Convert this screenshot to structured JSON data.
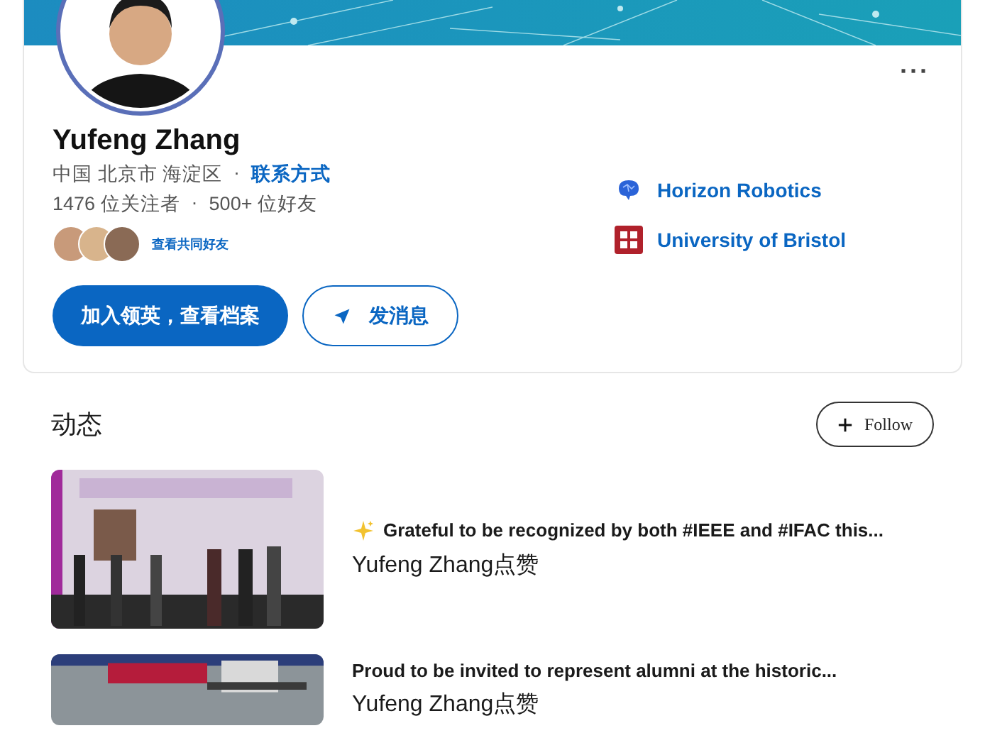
{
  "profile": {
    "name": "Yufeng Zhang",
    "location": "中国 北京市 海淀区",
    "separator": "·",
    "contact_link": "联系方式",
    "followers": "1476 位关注者",
    "connections": "500+ 位好友",
    "mutual_link": "查看共同好友",
    "mutual_avatars": [
      {
        "color": "#c89a7a"
      },
      {
        "color": "#d8b48c"
      },
      {
        "color": "#8a6a55"
      }
    ],
    "more": "···"
  },
  "organizations": [
    {
      "kind": "company",
      "name": "Horizon Robotics"
    },
    {
      "kind": "school",
      "name": "University of Bristol"
    }
  ],
  "buttons": [
    {
      "kind": "primary",
      "label": "加入领英，查看档案"
    },
    {
      "kind": "message",
      "label": "发消息"
    }
  ],
  "activity": {
    "title": "动态",
    "follow_button": "Follow",
    "posts": [
      {
        "sparkle": true,
        "text": "Grateful to be recognized by both #IEEE and #IFAC this...",
        "reaction": "Yufeng Zhang点赞"
      },
      {
        "sparkle": false,
        "text": "Proud to be invited to represent alumni at the historic...",
        "reaction": "Yufeng Zhang点赞"
      }
    ]
  }
}
